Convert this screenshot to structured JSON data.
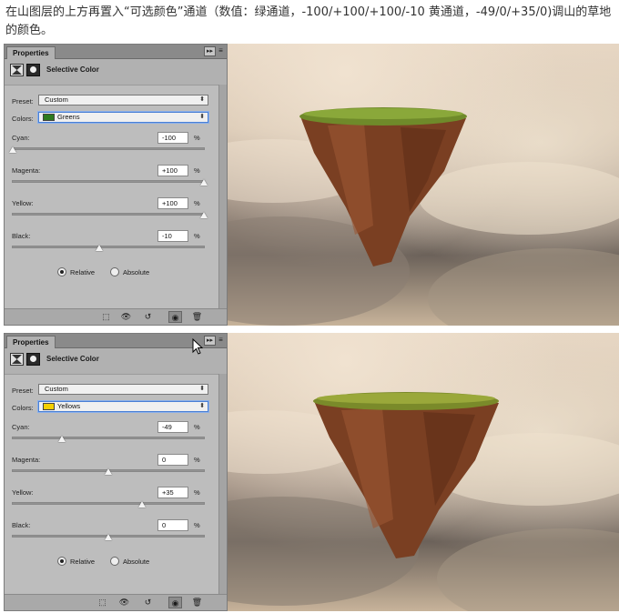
{
  "intro": {
    "text": "在山图层的上方再置入“可选颜色”通道（数值：绿通道，-100/+100/+100/-10  黄通道，-49/0/+35/0)调山的草地的颜色。"
  },
  "panels": [
    {
      "tab_label": "Properties",
      "collapse_label": "▸▸",
      "menu_label": "≡",
      "title": "Selective Color",
      "preset_label": "Preset:",
      "preset_value": "Custom",
      "colors_label": "Colors:",
      "colors_value": "Greens",
      "swatch_color": "#2d7a1e",
      "sliders": [
        {
          "label": "Cyan:",
          "value": "-100",
          "unit": "%",
          "level": -100
        },
        {
          "label": "Magenta:",
          "value": "+100",
          "unit": "%",
          "level": 100
        },
        {
          "label": "Yellow:",
          "value": "+100",
          "unit": "%",
          "level": 100
        },
        {
          "label": "Black:",
          "value": "-10",
          "unit": "%",
          "level": -10
        }
      ],
      "method_relative": "Relative",
      "method_absolute": "Absolute",
      "method_selected": "Relative"
    },
    {
      "tab_label": "Properties",
      "collapse_label": "▸▸",
      "menu_label": "≡",
      "title": "Selective Color",
      "preset_label": "Preset:",
      "preset_value": "Custom",
      "colors_label": "Colors:",
      "colors_value": "Yellows",
      "swatch_color": "#f5d000",
      "sliders": [
        {
          "label": "Cyan:",
          "value": "-49",
          "unit": "%",
          "level": -49
        },
        {
          "label": "Magenta:",
          "value": "0",
          "unit": "%",
          "level": 0
        },
        {
          "label": "Yellow:",
          "value": "+35",
          "unit": "%",
          "level": 35
        },
        {
          "label": "Black:",
          "value": "0",
          "unit": "%",
          "level": 0
        }
      ],
      "method_relative": "Relative",
      "method_absolute": "Absolute",
      "method_selected": "Relative"
    }
  ],
  "footer_icons": [
    "clip-to-layer-icon",
    "view-previous-state-icon",
    "reset-icon",
    "visibility-eye-icon",
    "delete-icon"
  ],
  "colors": {
    "panel_bg": "#b1b1b1",
    "focus_blue": "#4a7fd4",
    "grass": "#6f8a2a",
    "rock": "#8a4a2a"
  }
}
